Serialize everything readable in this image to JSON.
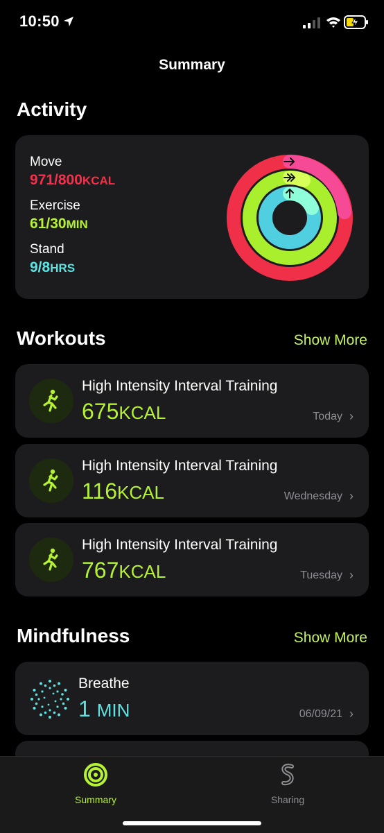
{
  "status": {
    "time": "10:50"
  },
  "nav": {
    "title": "Summary"
  },
  "activity": {
    "title": "Activity",
    "move": {
      "label": "Move",
      "value": "971/800",
      "unit": "KCAL"
    },
    "exercise": {
      "label": "Exercise",
      "value": "61/30",
      "unit": "MIN"
    },
    "stand": {
      "label": "Stand",
      "value": "9/8",
      "unit": "HRS"
    }
  },
  "workouts": {
    "title": "Workouts",
    "show_more": "Show More",
    "items": [
      {
        "name": "High Intensity Interval Training",
        "value": "675",
        "unit": "KCAL",
        "date": "Today"
      },
      {
        "name": "High Intensity Interval Training",
        "value": "116",
        "unit": "KCAL",
        "date": "Wednesday"
      },
      {
        "name": "High Intensity Interval Training",
        "value": "767",
        "unit": "KCAL",
        "date": "Tuesday"
      }
    ]
  },
  "mindfulness": {
    "title": "Mindfulness",
    "show_more": "Show More",
    "items": [
      {
        "name": "Breathe",
        "value": "1",
        "unit": "MIN",
        "date": "06/09/21"
      }
    ]
  },
  "tabbar": {
    "tabs": [
      {
        "label": "Summary",
        "active": true
      },
      {
        "label": "Sharing",
        "active": false
      }
    ]
  },
  "colors": {
    "move": "#f6304b",
    "exercise": "#b5f232",
    "stand": "#5ee3e3",
    "accent": "#c4f261"
  }
}
